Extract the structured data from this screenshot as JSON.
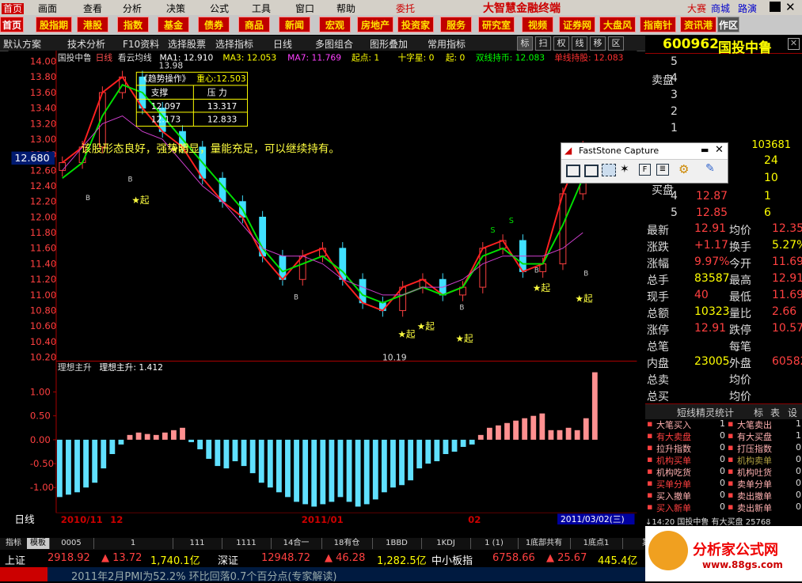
{
  "menu": [
    "首页",
    "画面",
    "查看",
    "分析",
    "决策",
    "公式",
    "工具",
    "窗口",
    "帮助"
  ],
  "menu_extra": {
    "broker": "委托",
    "brand": "大智慧金融终端",
    "links": [
      "大赛",
      "商城",
      "路演"
    ]
  },
  "nav": [
    "首页",
    "股指期",
    "港股",
    "指数",
    "基金",
    "债券",
    "商品",
    "新闻",
    "宏观",
    "房地产",
    "投资家",
    "服务",
    "研究室",
    "视频",
    "证券网",
    "大盘风",
    "指南针",
    "资讯港"
  ],
  "nav_right": "作区",
  "toolbar": [
    "默认方案",
    "技术分析",
    "F10资料",
    "选择股票",
    "选择指标",
    "日线",
    "多图组合",
    "图形叠加",
    "常用指标"
  ],
  "toolbar_keys": [
    "标",
    "扫",
    "权",
    "线",
    "移",
    "区"
  ],
  "stock": {
    "code": "600962",
    "name": "国投中鲁"
  },
  "indicator_line": {
    "name": "国投中鲁",
    "period": "日线",
    "template": "看云均线",
    "ma1": "MA1: 12.910",
    "ma3": "MA3: 12.053",
    "ma7": "MA7: 11.769",
    "qidian": "起点: 1",
    "shizixing": "十字星: 0",
    "qi": "起: 0",
    "shuangxian": "双线持币: 12.083",
    "danxian": "单线持股: 12.083"
  },
  "info_box": {
    "title": "《趋势操作》",
    "center": "重心:12.503",
    "h1": "支撑",
    "h2": "压 力",
    "r1": [
      "12.097",
      "13.317"
    ],
    "r2": [
      "12.173",
      "12.833"
    ]
  },
  "overlay_text": "该股形态良好，强势明显，量能充足，可以继续持有。",
  "price_label": "12.680",
  "low_label": "10.19",
  "high_label": "13.98",
  "chart_data": [
    {
      "type": "line",
      "title": "国投中鲁 日线",
      "ylim": [
        10.19,
        14.0
      ],
      "yticks": [
        "14.00",
        "13.80",
        "13.60",
        "13.40",
        "13.20",
        "13.00",
        "12.80",
        "12.60",
        "12.40",
        "12.20",
        "12.00",
        "11.80",
        "11.60",
        "11.40",
        "11.20",
        "11.00",
        "10.80",
        "10.60",
        "10.40",
        "10.20"
      ],
      "series": [
        {
          "name": "MA1",
          "values": [
            12.7,
            12.9,
            13.6,
            13.8,
            13.4,
            13.1,
            12.9,
            12.5,
            12.2,
            12.0,
            11.5,
            11.2,
            11.5,
            11.6,
            11.2,
            10.9,
            10.8,
            11.1,
            11.2,
            11.0,
            11.1,
            11.6,
            11.7,
            11.3,
            11.4,
            12.3,
            12.9
          ]
        },
        {
          "name": "MA3",
          "values": [
            12.5,
            12.7,
            13.3,
            13.7,
            13.6,
            13.3,
            13.0,
            12.7,
            12.4,
            12.1,
            11.6,
            11.3,
            11.4,
            11.5,
            11.3,
            11.0,
            10.9,
            11.0,
            11.1,
            11.0,
            11.1,
            11.5,
            11.6,
            11.4,
            11.4,
            11.9,
            12.5
          ]
        },
        {
          "name": "MA7",
          "values": [
            12.6,
            12.9,
            13.2,
            13.3,
            13.1,
            13.0,
            12.7,
            12.4,
            12.2,
            11.9,
            11.6,
            11.5,
            11.5,
            11.4,
            11.2,
            11.1,
            11.0,
            11.0,
            11.1,
            11.1,
            11.2,
            11.4,
            11.5,
            11.5,
            11.5,
            11.6,
            11.8
          ]
        }
      ],
      "markers": {
        "qi": "★起",
        "b": "B",
        "s": "S"
      }
    },
    {
      "type": "bar",
      "title": "理想主升",
      "value_label": "理想主升: 1.412",
      "yticks": [
        "1.00",
        "0.50",
        "0.00",
        "-0.50",
        "-1.00"
      ],
      "ylim": [
        -1.5,
        1.5
      ],
      "values": [
        -1.2,
        -1.15,
        -1.1,
        -1.0,
        -0.9,
        -0.6,
        -0.3,
        -0.1,
        0.1,
        0.15,
        0.12,
        0.1,
        0.15,
        0.2,
        0.25,
        -0.05,
        -0.2,
        -0.4,
        -0.55,
        -0.6,
        -0.45,
        -0.55,
        -0.7,
        -0.9,
        -1.0,
        -1.1,
        -1.2,
        -1.3,
        -1.35,
        -1.4,
        -1.35,
        -1.3,
        -1.2,
        -1.3,
        -1.4,
        -1.35,
        -1.25,
        -1.1,
        -1.0,
        -0.95,
        -0.85,
        -0.6,
        -0.5,
        -0.45,
        -0.3,
        -0.25,
        -0.15,
        -0.1,
        0.1,
        0.25,
        0.3,
        0.35,
        0.4,
        0.45,
        0.5,
        0.55,
        0.2,
        0.2,
        0.25,
        0.2,
        0.45,
        1.412
      ]
    }
  ],
  "xaxis": {
    "label": "日线",
    "dates": [
      "2010/11",
      "12",
      "2011/01",
      "02",
      "2011/03/02(三)"
    ]
  },
  "panel": {
    "sell_label": "卖盘",
    "buy_label": "买盘",
    "sell": [
      {
        "lvl": "5",
        "price": "",
        "vol": ""
      },
      {
        "lvl": "4",
        "price": "",
        "vol": ""
      },
      {
        "lvl": "3",
        "price": "",
        "vol": ""
      },
      {
        "lvl": "2",
        "price": "",
        "vol": ""
      },
      {
        "lvl": "1",
        "price": "",
        "vol": ""
      }
    ],
    "cur_vol": "103681",
    "buy": [
      {
        "lvl": "1",
        "price": "",
        "vol": "24"
      },
      {
        "lvl": "2",
        "price": "",
        "vol": "10"
      },
      {
        "lvl": "4",
        "price": "12.87",
        "vol": "1"
      },
      {
        "lvl": "5",
        "price": "12.85",
        "vol": "6"
      }
    ],
    "stats": [
      {
        "k": "最新",
        "v": "12.91",
        "k2": "均价",
        "v2": "12.35"
      },
      {
        "k": "涨跌",
        "v": "+1.17",
        "k2": "换手",
        "v2": "5.27%"
      },
      {
        "k": "涨幅",
        "v": "9.97%",
        "k2": "今开",
        "v2": "11.69"
      },
      {
        "k": "总手",
        "v": "83587",
        "k2": "最高",
        "v2": "12.91"
      },
      {
        "k": "现手",
        "v": "40",
        "k2": "最低",
        "v2": "11.69"
      },
      {
        "k": "总额",
        "v": "10323",
        "k2": "量比",
        "v2": "2.66"
      },
      {
        "k": "涨停",
        "v": "12.91",
        "k2": "跌停",
        "v2": "10.57"
      },
      {
        "k": "总笔",
        "v": "",
        "k2": "每笔",
        "v2": ""
      },
      {
        "k": "内盘",
        "v": "23005",
        "k2": "外盘",
        "v2": "60582"
      },
      {
        "k": "总卖",
        "v": "",
        "k2": "均价",
        "v2": ""
      },
      {
        "k": "总买",
        "v": "",
        "k2": "均价",
        "v2": ""
      }
    ],
    "tab_title": "短线精灵统计",
    "tabs": [
      "标",
      "表",
      "设"
    ],
    "sprites": [
      {
        "a": "大笔买入",
        "an": "1",
        "b": "大笔卖出",
        "bn": "1"
      },
      {
        "a": "有大卖盘",
        "an": "0",
        "b": "有大买盘",
        "bn": "1"
      },
      {
        "a": "拉升指数",
        "an": "0",
        "b": "打压指数",
        "bn": "0"
      },
      {
        "a": "机构买单",
        "an": "0",
        "b": "机构卖单",
        "bn": "0"
      },
      {
        "a": "机构吃货",
        "an": "0",
        "b": "机构吐货",
        "bn": "0"
      },
      {
        "a": "买单分单",
        "an": "0",
        "b": "卖单分单",
        "bn": "0"
      },
      {
        "a": "买入撤单",
        "an": "0",
        "b": "卖出撤单",
        "bn": "0"
      },
      {
        "a": "买入新单",
        "an": "0",
        "b": "卖出新单",
        "bn": "0"
      }
    ],
    "last_trade": "↓14:20 国投中鲁 有大买盘 25768"
  },
  "fs_capture": {
    "title": "FastStone Capture"
  },
  "status_tabs": [
    "指标",
    "模板",
    "0005",
    "1",
    "111",
    "1111",
    "14合一",
    "18有仓",
    "1BBD",
    "1KDJ",
    "1 (1)",
    "1底部共有",
    "1底点1",
    "其他"
  ],
  "bottom": {
    "sh": "上证",
    "sh_v": "2918.92",
    "sh_c": "▲ 13.72",
    "sh_a": "1,740.1亿",
    "sz": "深证",
    "sz_v": "12948.72",
    "sz_c": "▲ 46.28",
    "sz_a": "1,282.5亿",
    "zx": "中小板指",
    "zx_v": "6758.66",
    "zx_c": "▲ 25.67",
    "zx_a": "445.4亿"
  },
  "ticker": "2011年2月PMI为52.2% 环比回落0.7个百分点(专家解读)",
  "logo": {
    "text": "分析家公式网",
    "url": "www.88gs.com"
  }
}
